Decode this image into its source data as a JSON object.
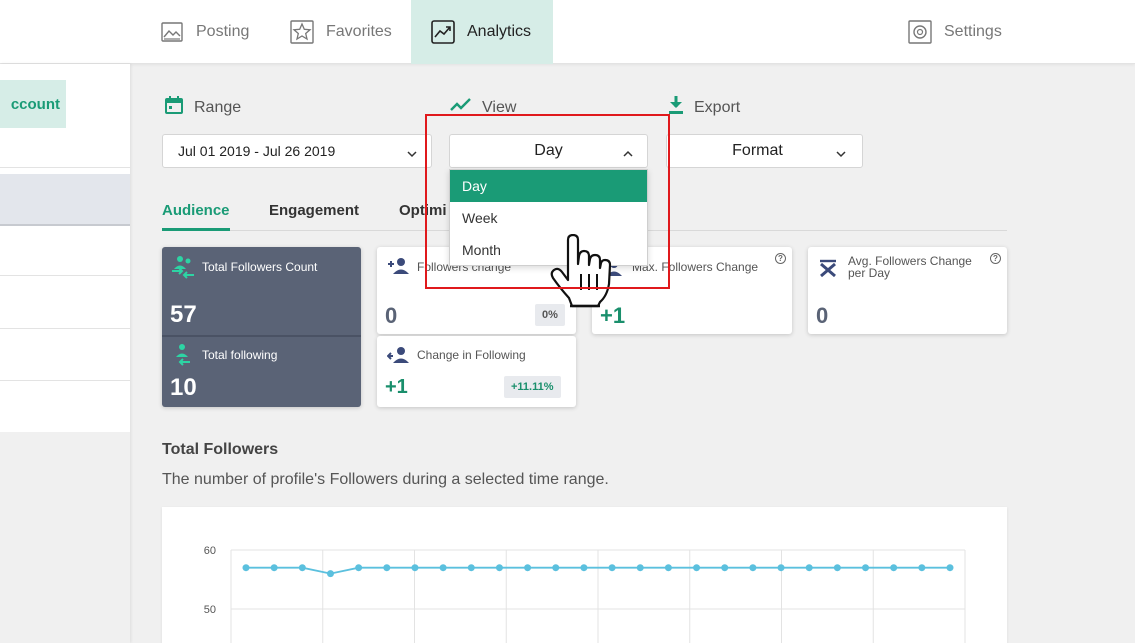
{
  "nav": {
    "posting": "Posting",
    "favorites": "Favorites",
    "analytics": "Analytics",
    "settings": "Settings"
  },
  "sidebar": {
    "account_label": "ccount"
  },
  "filters": {
    "range_label": "Range",
    "range_value": "Jul 01 2019 - Jul 26 2019",
    "view_label": "View",
    "view_value": "Day",
    "export_label": "Export",
    "export_value": "Format"
  },
  "dropdown": {
    "options": [
      "Day",
      "Week",
      "Month"
    ],
    "selected": "Day"
  },
  "subtabs": [
    "Audience",
    "Engagement",
    "Optimi"
  ],
  "cards": {
    "total_followers": {
      "title": "Total Followers Count",
      "value": "57"
    },
    "total_following": {
      "title": "Total following",
      "value": "10"
    },
    "followers_change": {
      "title": "Followers change",
      "value": "0",
      "badge": "0%"
    },
    "change_following": {
      "title": "Change in Following",
      "value": "+1",
      "badge": "+11.11%"
    },
    "max_followers_change": {
      "title": "Max. Followers Change",
      "value": "+1"
    },
    "avg_followers_change": {
      "title_line1": "Avg. Followers Change",
      "title_line2": "per Day",
      "value": "0"
    }
  },
  "section": {
    "title": "Total Followers",
    "description": "The number of profile's Followers during a selected time range."
  },
  "colors": {
    "accent": "#1a9b76",
    "dark_card": "#5a6376",
    "highlight": "#e0191c",
    "line": "#5bc0de"
  },
  "chart_data": {
    "type": "line",
    "x": [
      1,
      2,
      3,
      4,
      5,
      6,
      7,
      8,
      9,
      10,
      11,
      12,
      13,
      14,
      15,
      16,
      17,
      18,
      19,
      20,
      21,
      22,
      23,
      24,
      25,
      26
    ],
    "series": [
      {
        "values": [
          57,
          57,
          57,
          56,
          57,
          57,
          57,
          57,
          57,
          57,
          57,
          57,
          57,
          57,
          57,
          57,
          57,
          57,
          57,
          57,
          57,
          57,
          57,
          57,
          57,
          57
        ]
      }
    ],
    "y_ticks": [
      "60",
      "50"
    ],
    "ylim": [
      40,
      60
    ],
    "grid": true
  }
}
